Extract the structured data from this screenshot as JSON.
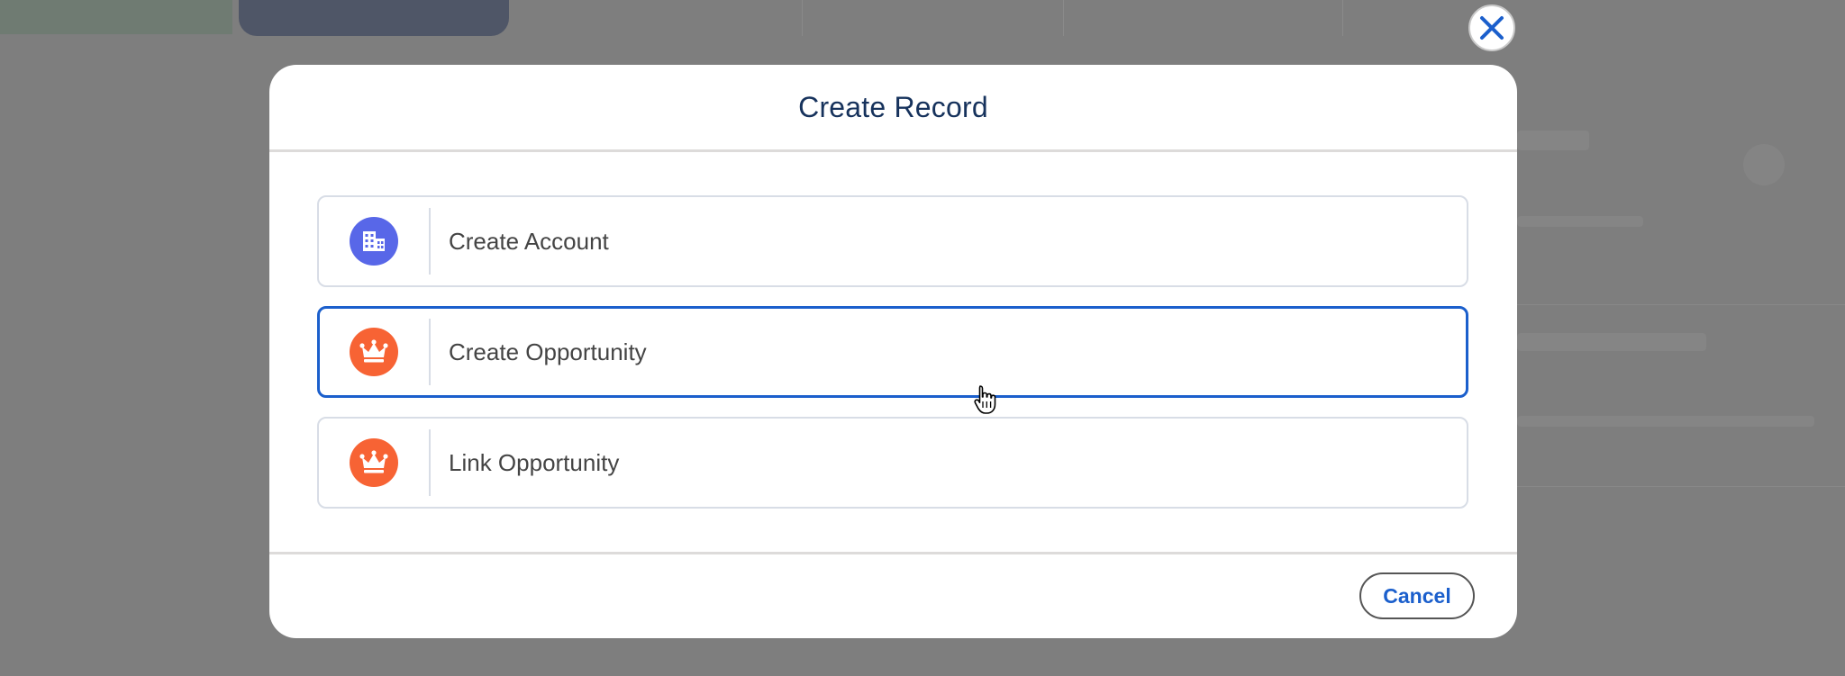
{
  "modal": {
    "title": "Create Record",
    "options": [
      {
        "label": "Create Account",
        "icon": "account-building-icon",
        "icon_color": "#5867e8",
        "selected": false
      },
      {
        "label": "Create Opportunity",
        "icon": "opportunity-crown-icon",
        "icon_color": "#f76334",
        "selected": true
      },
      {
        "label": "Link Opportunity",
        "icon": "opportunity-crown-icon",
        "icon_color": "#f76334",
        "selected": false
      }
    ],
    "cancel_label": "Cancel"
  },
  "close_button": {
    "icon": "close-icon"
  },
  "colors": {
    "accent": "#1b5fcc",
    "title": "#16325c",
    "account_icon": "#5867e8",
    "opportunity_icon": "#f76334",
    "overlay": "#7e7e7e"
  }
}
